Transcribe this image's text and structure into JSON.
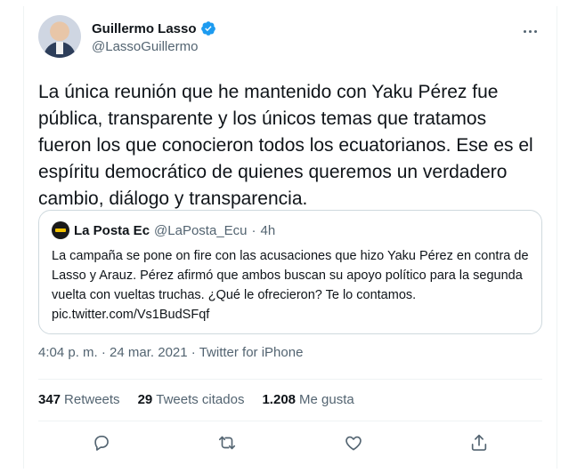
{
  "author": {
    "display_name": "Guillermo Lasso",
    "handle": "@LassoGuillermo"
  },
  "tweet": {
    "text": "La única reunión que he mantenido con Yaku Pérez fue pública, transparente y los únicos temas que tratamos fueron los que conocieron todos los ecuatorianos. Ese es el espíritu democrático de quienes queremos un verdadero cambio, diálogo y transparencia.",
    "time": "4:04 p. m.",
    "separator": "·",
    "date": "24 mar. 2021",
    "source": "Twitter for iPhone"
  },
  "quote": {
    "display_name": "La Posta Ec",
    "handle": "@LaPosta_Ecu",
    "separator": "·",
    "age": "4h",
    "text": "La campaña se pone on fire con las acusaciones que hizo Yaku Pérez en contra de Lasso y Arauz. Pérez afirmó que ambos buscan su apoyo político para la segunda vuelta con vueltas truchas. ¿Qué le ofrecieron? Te lo contamos.",
    "link": "pic.twitter.com/Vs1BudSFqf"
  },
  "stats": {
    "retweets_count": "347",
    "retweets_label": "Retweets",
    "quotes_count": "29",
    "quotes_label": "Tweets citados",
    "likes_count": "1.208",
    "likes_label": "Me gusta"
  },
  "icons": {
    "verified": "verified-badge-icon",
    "more": "more-horizontal-icon",
    "reply": "reply-icon",
    "retweet": "retweet-icon",
    "like": "heart-icon",
    "share": "share-icon"
  },
  "colors": {
    "verified": "#1d9bf0",
    "secondary_text": "#536471",
    "primary_text": "#0f1419"
  }
}
